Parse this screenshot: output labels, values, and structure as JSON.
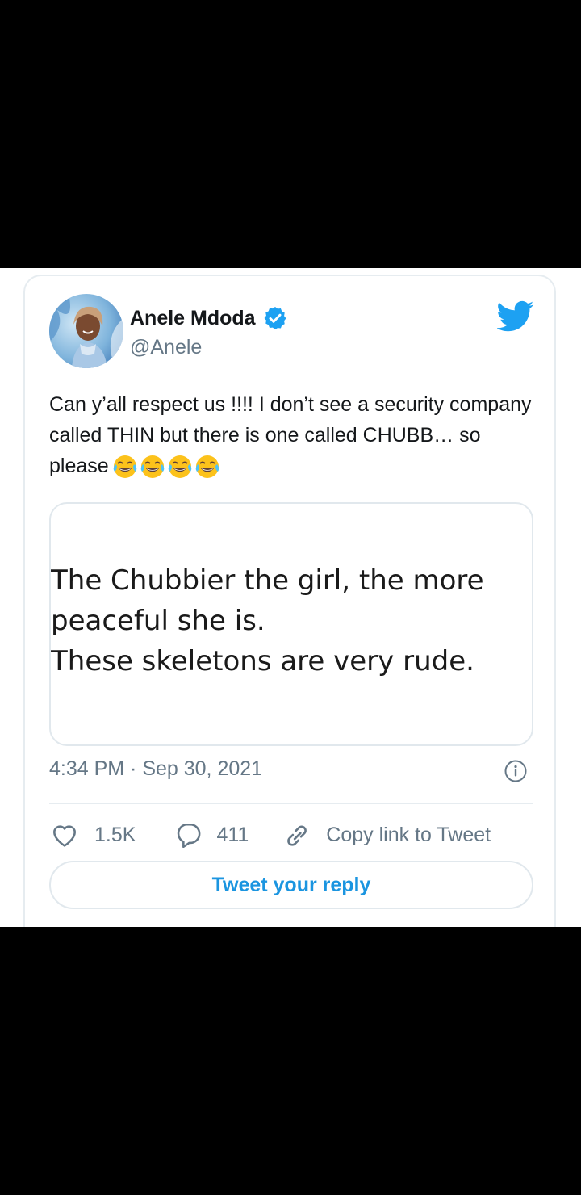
{
  "author": {
    "name": "Anele Mdoda",
    "handle": "@Anele",
    "verified": true
  },
  "tweet": {
    "text": "Can y’all respect us !!!! I don’t see a security company called THIN but there is one called CHUBB… so please",
    "emojis": [
      "face-with-tears-of-joy",
      "face-with-tears-of-joy",
      "face-with-tears-of-joy",
      "face-with-tears-of-joy"
    ]
  },
  "quoted_image": {
    "lines": [
      "The Chubbier the girl, the more",
      "peaceful she is.",
      "These skeletons are very rude."
    ]
  },
  "meta": {
    "timestamp": "4:34 PM · Sep 30, 2021"
  },
  "actions": {
    "likes": "1.5K",
    "replies": "411",
    "copy_link": "Copy link to Tweet",
    "reply_button": "Tweet your reply"
  },
  "colors": {
    "brand_blue": "#1da1f2",
    "link_blue": "#1b95e0",
    "secondary_text": "#657786",
    "primary_text": "#14171a",
    "border": "#e6ecf0"
  },
  "icons": [
    "avatar",
    "verified-badge-icon",
    "twitter-bird-icon",
    "laughing-emoji-icon",
    "info-icon",
    "heart-icon",
    "reply-bubble-icon",
    "link-icon"
  ]
}
